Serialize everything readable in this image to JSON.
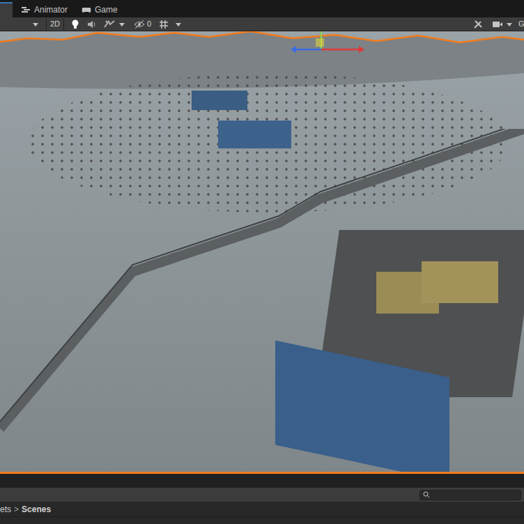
{
  "tabs": [
    {
      "label": "",
      "selected": true
    },
    {
      "label": "Animator",
      "selected": false
    },
    {
      "label": "Game",
      "selected": false
    }
  ],
  "toolbar": {
    "mode_button": "2D",
    "mode_2d_on": false,
    "lighting_on": true,
    "audio_on": false,
    "effects_on": false,
    "hidden_count": "0",
    "gizmos_label": "G"
  },
  "scene": {
    "selection_outlined": true
  },
  "project": {
    "breadcrumb": [
      "ets",
      "Scenes"
    ],
    "separator": ">",
    "search": {
      "placeholder": ""
    }
  }
}
